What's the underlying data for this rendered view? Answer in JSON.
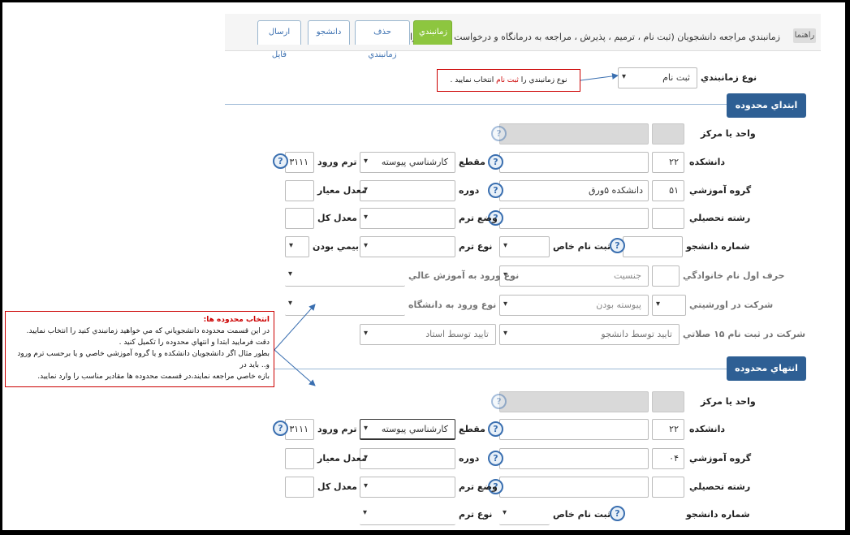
{
  "header": {
    "badge": "راهنما",
    "title": "زمانبندي مراجعه دانشجويان (ثبت نام ، ترميم ، پذيرش ، مراجعه به درمانگاه و درخواست گروهي خوابگاه)",
    "tabs": [
      {
        "label": "زمانبندي",
        "active": true
      },
      {
        "label": "حذف زمانبندي",
        "active": false
      },
      {
        "label": "دانشجو",
        "active": false
      },
      {
        "label": "ارسال فايل",
        "active": false
      }
    ]
  },
  "schedule_type": {
    "label": "نوع زمانبندي",
    "value": "ثبت نام"
  },
  "hint_top": {
    "prefix": "نوع زمانبندي را",
    "highlight": "ثبت نام",
    "suffix": "انتخاب نماييد ."
  },
  "start_section": {
    "title": "ابتداي محدوده دانشجو",
    "unit": {
      "label": "واحد يا مركز"
    },
    "faculty": {
      "label": "دانشكده",
      "value": "۲۲"
    },
    "level": {
      "label": "مقطع",
      "value": "كارشناسي پيوسته"
    },
    "entry_term": {
      "label": "ترم ورود",
      "value": "۳۱۱۱"
    },
    "group": {
      "label": "گروه آموزشي",
      "value": "۵۱",
      "name": "دانشكده ۵ورق"
    },
    "course": {
      "label": "دوره"
    },
    "criteria_avg": {
      "label": "معدل معيار"
    },
    "field": {
      "label": "رشته تحصيلي"
    },
    "term_status": {
      "label": "وضع ترم"
    },
    "total_avg": {
      "label": "معدل كل"
    },
    "student_no": {
      "label": "شماره دانشجو"
    },
    "special_reg": {
      "label": "ثبت نام خاص"
    },
    "term_type": {
      "label": "نوع ترم"
    },
    "insured": {
      "label": "بيمي بودن"
    },
    "family_letter": {
      "label": "حرف اول نام خانوادگي"
    },
    "gender": {
      "label": "جنسيت"
    },
    "entry_type_hi": {
      "label": "نوع ورود به آموزش عالي"
    },
    "orientation": {
      "label": "شركت در اورشيتي"
    },
    "continuous": {
      "label": "پيوسته بودن"
    },
    "entry_type_uni": {
      "label": "نوع ورود به دانشگاه"
    },
    "reg_part": {
      "label": "شركت در ثبت نام ۱۵ صلاتي"
    },
    "student_confirm": {
      "label": "تاييد توسط دانشجو"
    },
    "professor_confirm": {
      "label": "تاييد توسط استاد"
    }
  },
  "end_section": {
    "title": "انتهاي محدوده دانشجو",
    "unit": {
      "label": "واحد يا مركز"
    },
    "faculty": {
      "label": "دانشكده",
      "value": "۲۲"
    },
    "level": {
      "label": "مقطع",
      "value": "كارشناسي پيوسته"
    },
    "entry_term": {
      "label": "ترم ورود",
      "value": "۳۱۱۱"
    },
    "group": {
      "label": "گروه آموزشي",
      "value": "۰۴"
    },
    "course": {
      "label": "دوره"
    },
    "criteria_avg": {
      "label": "معدل معيار"
    },
    "field": {
      "label": "رشته تحصيلي"
    },
    "term_status": {
      "label": "وضع ترم"
    },
    "total_avg": {
      "label": "معدل كل"
    },
    "student_no": {
      "label": "شماره دانشجو"
    },
    "special_reg": {
      "label": "ثبت نام خاص"
    },
    "term_type": {
      "label": "نوع ترم"
    }
  },
  "callout": {
    "title": "انتخاب محدوده ها:",
    "lines": [
      "در اين قسمت محدوده  دانشجوياني كه مي خواهيد زمانبندي كنيد را انتخاب نماييد.",
      "دقت فرماييد ابتدا و انتهاي محدوده را تكميل كنيد .",
      "بطور مثال اگر دانشجويان دانشكده و يا گروه آموزشي خاصي و يا برحسب ترم ورود  و.. بايد در",
      "بازه خاصي مراجعه نمايند،در قسمت محدوده ها مقادير مناسب را وارد نماييد."
    ]
  },
  "colors": {
    "accent": "#2e5f94",
    "active_tab": "#8dc63f",
    "callout_border": "#cc0000",
    "arrow": "#3a6fb0"
  }
}
